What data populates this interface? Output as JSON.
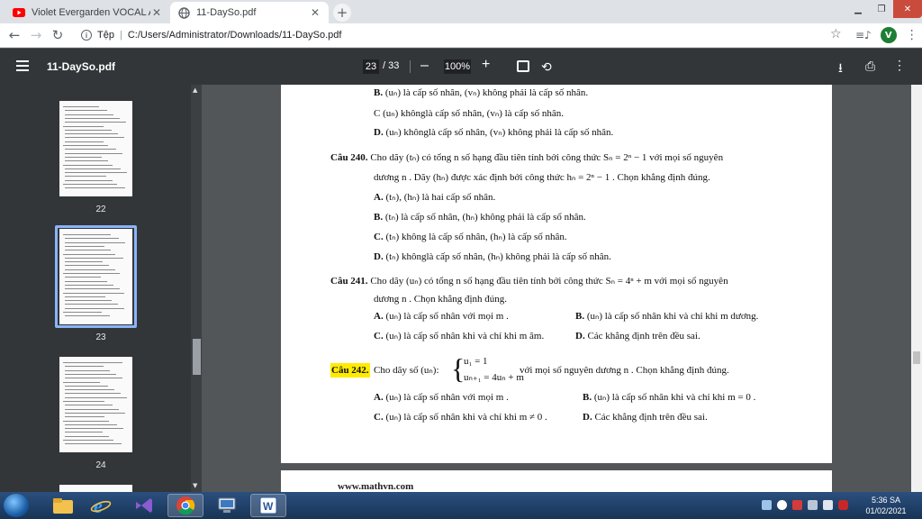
{
  "browser": {
    "tabs": [
      {
        "title": "Violet Evergarden VOCAL AL",
        "favicon": "youtube-icon"
      },
      {
        "title": "11-DaySo.pdf",
        "favicon": "globe-icon"
      }
    ],
    "address": {
      "scheme_label": "Tệp",
      "url": "C:/Users/Administrator/Downloads/11-DaySo.pdf"
    },
    "avatar_letter": "V"
  },
  "pdf_toolbar": {
    "filename": "11-DaySo.pdf",
    "current_page": "23",
    "total_pages": "/ 33",
    "zoom": "100%",
    "zoom_out": "–",
    "zoom_in": "+"
  },
  "thumbnails": [
    {
      "number": "22",
      "selected": false
    },
    {
      "number": "23",
      "selected": true
    },
    {
      "number": "24",
      "selected": false
    }
  ],
  "document": {
    "prev_options": [
      {
        "label": "B.",
        "text": "(uₙ) là cấp số nhân, (vₙ) không phải là cấp số nhân."
      },
      {
        "label": "C",
        "text": "(uₙ) khônglà cấp số nhân, (vₙ) là cấp số nhân."
      },
      {
        "label": "D.",
        "text": "(uₙ) khônglà cấp số nhân, (vₙ) không phải là cấp số nhân."
      }
    ],
    "q240": {
      "label": "Câu 240.",
      "line1": "Cho dãy (tₙ) có tổng n số hạng đầu tiên tính bởi công thức Sₙ = 2ⁿ − 1 với mọi số nguyên",
      "line2": "dương n . Dãy (hₙ) được xác định bởi công thức hₙ = 2ⁿ − 1 . Chọn khẳng định đúng.",
      "options": [
        {
          "label": "A.",
          "text": "(tₙ), (hₙ) là hai cấp số nhân."
        },
        {
          "label": "B.",
          "text": "(tₙ) là cấp số nhân, (hₙ) không phải là cấp số nhân."
        },
        {
          "label": "C.",
          "text": "(tₙ) không là cấp số nhân, (hₙ) là cấp số nhân."
        },
        {
          "label": "D.",
          "text": "(tₙ) khônglà cấp số nhân, (hₙ) không phải là cấp số nhân."
        }
      ]
    },
    "q241": {
      "label": "Câu 241.",
      "line1": "Cho dãy (uₙ) có tổng n số hạng đầu tiên tính bởi công thức Sₙ = 4ⁿ + m với mọi số nguyên",
      "line2": "dương n . Chọn khẳng định đúng.",
      "options": [
        {
          "label": "A.",
          "text": "(uₙ) là cấp số nhân với mọi m ."
        },
        {
          "label": "B.",
          "text": "(uₙ) là cấp số nhân khi và chỉ khi m dương."
        },
        {
          "label": "C.",
          "text": "(uₙ) là cấp số nhân khi và chỉ khi m âm."
        },
        {
          "label": "D.",
          "text": "Các khẳng định trên đều sai."
        }
      ]
    },
    "q242": {
      "label": "Câu 242.",
      "intro": "Cho dãy số (uₙ):",
      "system_line1": "u₁ = 1",
      "system_line2": "uₙ₊₁ = 4uₙ + m",
      "rest": "với mọi số nguyên dương n . Chọn khẳng định đúng.",
      "options": [
        {
          "label": "A.",
          "text": "(uₙ) là cấp số nhân với mọi m ."
        },
        {
          "label": "B.",
          "text": "(uₙ) là cấp số nhân khi và chỉ khi m = 0 ."
        },
        {
          "label": "C.",
          "text": "(uₙ) là cấp số nhân khi và chỉ khi m ≠ 0 ."
        },
        {
          "label": "D.",
          "text": "Các khẳng định trên đều sai."
        }
      ]
    },
    "footer_url": "www.mathvn.com"
  },
  "taskbar": {
    "time": "5:36 SA",
    "date": "01/02/2021"
  },
  "colors": {
    "highlight": "#ffeb00",
    "pdf_toolbar": "#323639",
    "selection": "#8ab4f8"
  }
}
